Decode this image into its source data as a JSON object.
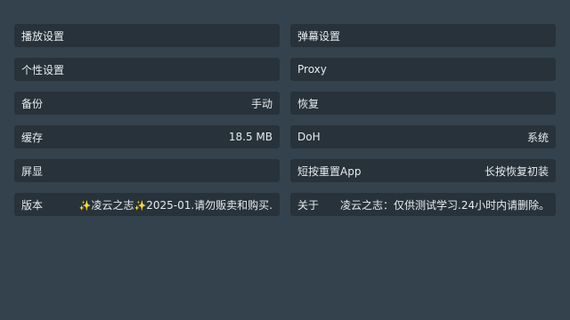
{
  "left": {
    "playback": "播放设置",
    "personal": "个性设置",
    "backup": {
      "label": "备份",
      "value": "手动"
    },
    "cache": {
      "label": "缓存",
      "value": "18.5 MB"
    },
    "screen": "屏显",
    "version": {
      "label": "版本",
      "sparkle": "✨",
      "brand": "凌云之志",
      "value": "2025-01.请勿贩卖和购买."
    }
  },
  "right": {
    "danmaku": "弹幕设置",
    "proxy": "Proxy",
    "restore": "恢复",
    "doh": {
      "label": "DoH",
      "value": "系统"
    },
    "reset": {
      "label": "短按重置App",
      "value": "长按恢复初装"
    },
    "about": {
      "label": "关于",
      "value": "凌云之志：仅供测试学习.24小时内请删除。"
    }
  }
}
